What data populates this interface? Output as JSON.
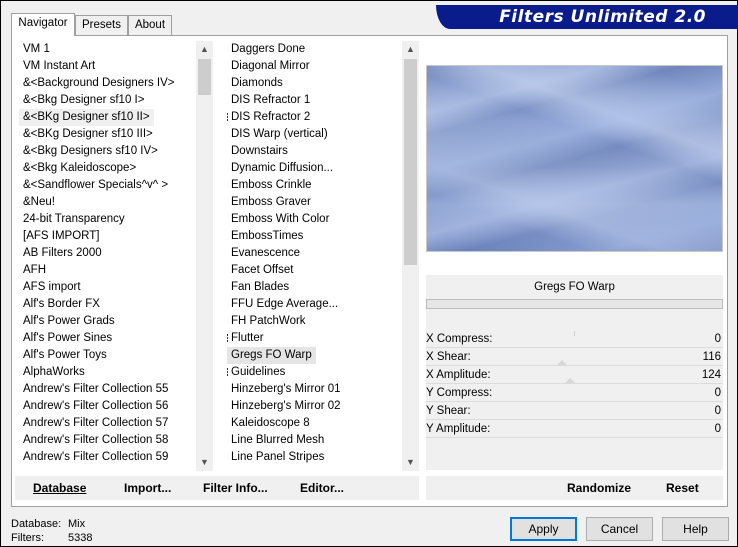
{
  "tabs": [
    {
      "label": "Navigator"
    },
    {
      "label": "Presets"
    },
    {
      "label": "About"
    }
  ],
  "banner": {
    "title": "Filters Unlimited 2.0"
  },
  "categories": [
    "VM 1",
    "VM Instant Art",
    "&<Background Designers IV>",
    "&<Bkg Designer sf10 I>",
    "&<BKg Designer sf10 II>",
    "&<BKg Designer sf10 III>",
    "&<Bkg Designers sf10 IV>",
    "&<Bkg Kaleidoscope>",
    "&<Sandflower Specials^v^ >",
    "&Neu!",
    "24-bit Transparency",
    "[AFS IMPORT]",
    "AB Filters 2000",
    "AFH",
    "AFS import",
    "Alf's Border FX",
    "Alf's Power Grads",
    "Alf's Power Sines",
    "Alf's Power Toys",
    "AlphaWorks",
    "Andrew's Filter Collection 55",
    "Andrew's Filter Collection 56",
    "Andrew's Filter Collection 57",
    "Andrew's Filter Collection 58",
    "Andrew's Filter Collection 59"
  ],
  "filters": [
    "Daggers Done",
    "Diagonal Mirror",
    "Diamonds",
    "DIS Refractor 1",
    "DIS Refractor 2",
    "DIS Warp (vertical)",
    "Downstairs",
    "Dynamic Diffusion...",
    "Emboss Crinkle",
    "Emboss Graver",
    "Emboss With Color",
    "EmbossTimes",
    "Evanescence",
    "Facet Offset",
    "Fan Blades",
    "FFU Edge Average...",
    "FH PatchWork",
    "Flutter",
    "Gregs FO Warp",
    "Guidelines",
    "Hinzeberg's Mirror 01",
    "Hinzeberg's Mirror 02",
    "Kaleidoscope 8",
    "Line Blurred Mesh",
    "Line Panel Stripes"
  ],
  "selected_filter": "Gregs FO Warp",
  "params": [
    {
      "label": "X Compress:",
      "value": "0"
    },
    {
      "label": "X Shear:",
      "value": "116"
    },
    {
      "label": "X Amplitude:",
      "value": "124"
    },
    {
      "label": "Y Compress:",
      "value": "0"
    },
    {
      "label": "Y Shear:",
      "value": "0"
    },
    {
      "label": "Y Amplitude:",
      "value": "0"
    }
  ],
  "toolbar": {
    "database": "Database",
    "import": "Import...",
    "filter_info": "Filter Info...",
    "editor": "Editor...",
    "randomize": "Randomize",
    "reset": "Reset"
  },
  "status": {
    "database_label": "Database:",
    "database_value": "Mix",
    "filters_label": "Filters:",
    "filters_value": "5338"
  },
  "buttons": {
    "apply": "Apply",
    "cancel": "Cancel",
    "help": "Help"
  }
}
